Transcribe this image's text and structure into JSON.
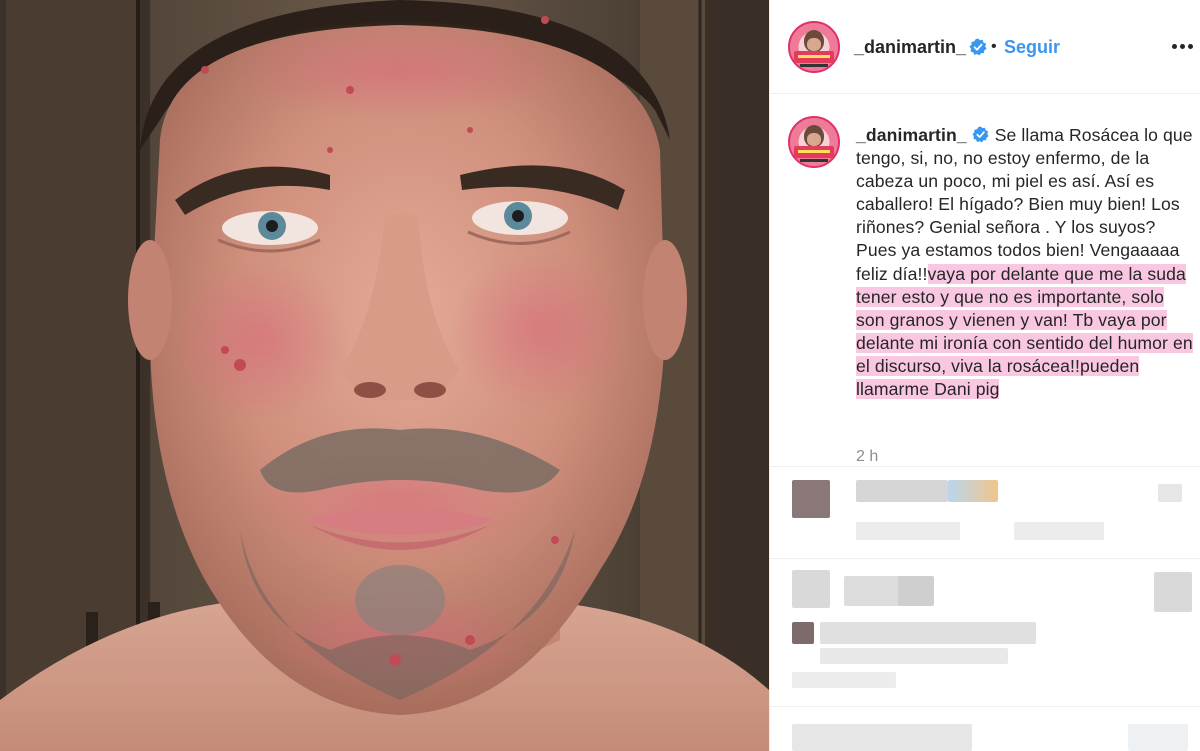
{
  "post": {
    "author": {
      "username": "_danimartin_",
      "verified": true,
      "follow_label": "Seguir",
      "separator": "•"
    },
    "caption": {
      "username": "_danimartin_",
      "text_plain": "Se llama Rosácea lo que tengo, si, no, no estoy enfermo, de la cabeza un poco, mi piel es así. Así es caballero! El hígado? Bien muy bien! Los riñones? Genial señora . Y los suyos? Pues ya estamos todos bien! Vengaaaaa feliz día!!",
      "text_highlighted": "vaya por delante que me la suda tener esto y que no es importante, solo son granos y vienen y van! Tb vaya por delante mi ironía con sentido del humor en el discurso, viva la rosácea!!pueden llamarme Dani pig"
    },
    "time_ago": "2 h"
  },
  "colors": {
    "accent": "#3897f0",
    "highlight": "#f9c7e1",
    "verified_badge": "#3897f0",
    "secondary_text": "#8e8e8e"
  },
  "icons": [
    "verified-badge-icon",
    "more-options-icon"
  ]
}
